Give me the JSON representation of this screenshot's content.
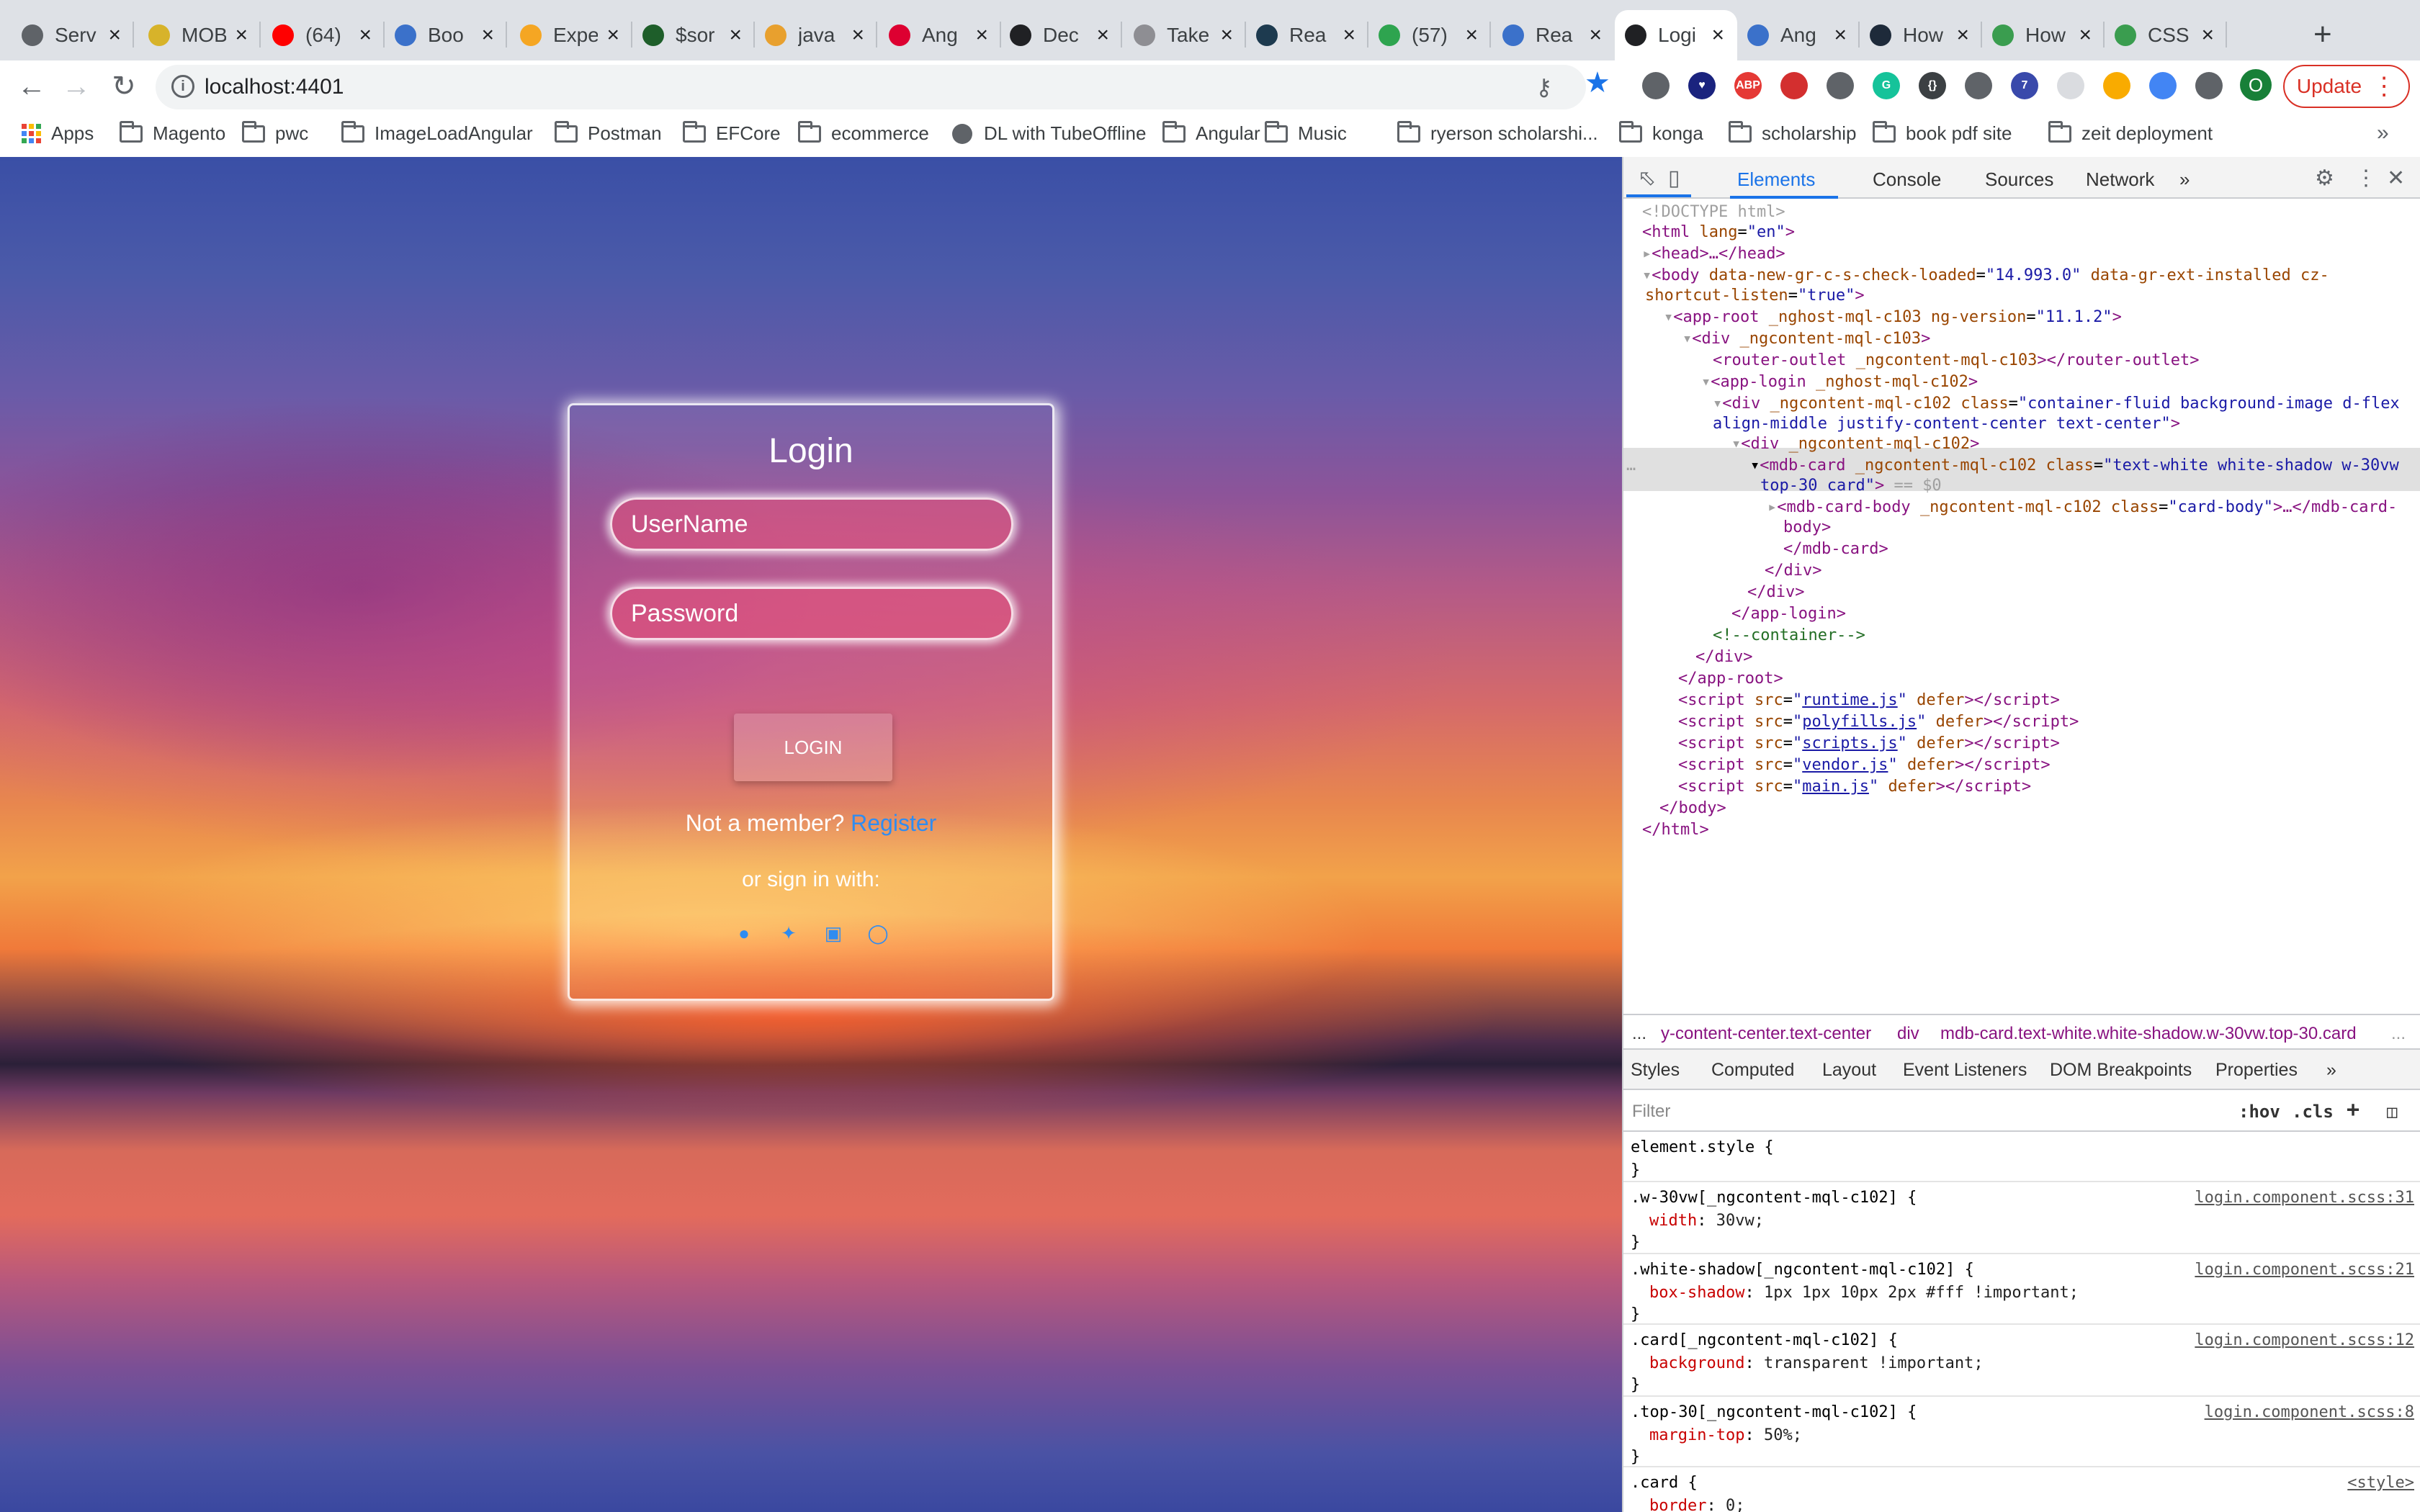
{
  "browser": {
    "tabs": [
      {
        "title": "Serv",
        "color": "#5f6368"
      },
      {
        "title": "MOB",
        "color": "#d7b32a"
      },
      {
        "title": "(64)",
        "color": "#ff0000"
      },
      {
        "title": "Boo",
        "color": "#3b71ca"
      },
      {
        "title": "Expe",
        "color": "#f5a623"
      },
      {
        "title": "$sor",
        "color": "#1e5e2a"
      },
      {
        "title": "java",
        "color": "#e8a02e"
      },
      {
        "title": "Ang",
        "color": "#dd0031"
      },
      {
        "title": "Dec",
        "color": "#202124"
      },
      {
        "title": "Take",
        "color": "#8e8e93"
      },
      {
        "title": "Rea",
        "color": "#1d3a4f"
      },
      {
        "title": "(57)",
        "color": "#2ea44f"
      },
      {
        "title": "Rea",
        "color": "#3b71ca"
      },
      {
        "title": "Logi",
        "color": "#202124"
      },
      {
        "title": "Ang",
        "color": "#3b71ca"
      },
      {
        "title": "How",
        "color": "#1e2a3a"
      },
      {
        "title": "How",
        "color": "#3a9d4f"
      },
      {
        "title": "CSS",
        "color": "#3a9d4f"
      }
    ],
    "address": "localhost:4401",
    "update_label": "Update",
    "bookmarks": [
      "Apps",
      "Magento",
      "pwc",
      "ImageLoadAngular",
      "Postman",
      "EFCore",
      "ecommerce",
      "DL with TubeOffline",
      "Angular",
      "Music",
      "ryerson scholarshi...",
      "konga",
      "scholarship",
      "book pdf site",
      "zeit deployment"
    ],
    "profile_initial": "O"
  },
  "login": {
    "title": "Login",
    "username_placeholder": "UserName",
    "password_placeholder": "Password",
    "button": "LOGIN",
    "not_member": "Not a member?",
    "register": "Register",
    "signin_with": "or sign in with:"
  },
  "devtools": {
    "tabs": [
      "Elements",
      "Console",
      "Sources",
      "Network"
    ],
    "dom": {
      "doctype": "<!DOCTYPE html>",
      "html_tag": "<html",
      "lang_attr": "lang",
      "lang_val": "\"en\"",
      "head": "<head>…</head>",
      "body_open": "<body",
      "body_attr1": "data-new-gr-c-s-check-loaded",
      "body_val1": "\"14.993.0\"",
      "body_attr2": "data-gr-ext-installed cz-",
      "body_attr3": "shortcut-listen",
      "body_val3": "\"true\"",
      "approot": "<app-root",
      "approot_attr": "_nghost-mql-c103 ng-version",
      "approot_val": "\"11.1.2\"",
      "div1": "<div",
      "div1_attr": "_ngcontent-mql-c103",
      "router": "<router-outlet",
      "router_attr": "_ngcontent-mql-c103",
      "router_close": "></router-outlet>",
      "applogin": "<app-login",
      "applogin_attr": "_nghost-mql-c102",
      "div2": "<div",
      "div2_attr": "_ngcontent-mql-c102 class",
      "div2_val": "\"container-fluid background-image d-flex",
      "div2_val2": "align-middle justify-content-center text-center\"",
      "div3": "<div",
      "div3_attr": "_ngcontent-mql-c102",
      "mdbcard": "<mdb-card",
      "mdbcard_attr": "_ngcontent-mql-c102 class",
      "mdbcard_val": "\"text-white white-shadow w-30vw",
      "mdbcard_val2": "top-30 card\"",
      "mdbcard_eq": "== $0",
      "cardbody": "<mdb-card-body",
      "cardbody_attr": "_ngcontent-mql-c102 class",
      "cardbody_val": "\"card-body\"",
      "cardbody_close": ">…</mdb-card-",
      "cardbody_close2": "body>",
      "mdbcard_close": "</mdb-card>",
      "div_close": "</div>",
      "applogin_close": "</app-login>",
      "comment": "<!--container-->",
      "approot_close": "</app-root>",
      "scripts": [
        "runtime.js",
        "polyfills.js",
        "scripts.js",
        "vendor.js",
        "main.js"
      ],
      "body_close": "</body>",
      "html_close": "</html>"
    },
    "breadcrumbs": [
      "...",
      "y-content-center.text-center",
      "div",
      "mdb-card.text-white.white-shadow.w-30vw.top-30.card",
      "..."
    ],
    "style_tabs": [
      "Styles",
      "Computed",
      "Layout",
      "Event Listeners",
      "DOM Breakpoints",
      "Properties"
    ],
    "filter_placeholder": "Filter",
    "filter_hov": ":hov",
    "filter_cls": ".cls",
    "rules": [
      {
        "selector": "element.style {",
        "prop": "",
        "value": "",
        "source": ""
      },
      {
        "selector": ".w-30vw[_ngcontent-mql-c102] {",
        "prop": "width",
        "value": "30vw;",
        "source": "login.component.scss:31"
      },
      {
        "selector": ".white-shadow[_ngcontent-mql-c102] {",
        "prop": "box-shadow",
        "value": "1px 1px 10px 2px #fff !important;",
        "source": "login.component.scss:21"
      },
      {
        "selector": ".card[_ngcontent-mql-c102] {",
        "prop": "background",
        "value": "transparent !important;",
        "source": "login.component.scss:12"
      },
      {
        "selector": ".top-30[_ngcontent-mql-c102] {",
        "prop": "margin-top",
        "value": "50%;",
        "source": "login.component.scss:8"
      },
      {
        "selector": ".card {",
        "prop": "border",
        "value": "0;",
        "source": "<style>"
      }
    ]
  }
}
